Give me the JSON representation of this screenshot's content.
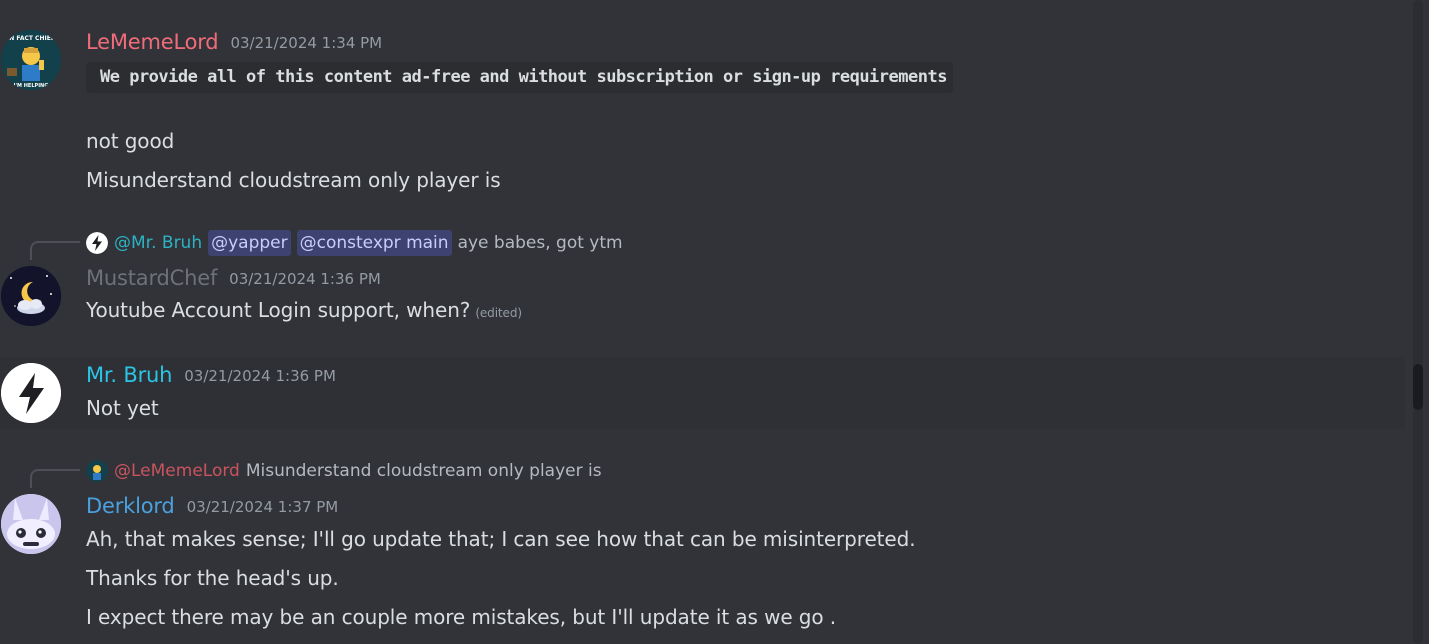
{
  "messages": [
    {
      "author": "LeMemeLord",
      "author_color": "#f16c7a",
      "timestamp": "03/21/2024 1:34 PM",
      "code": "We provide all of this content ad-free and without subscription or sign-up requirements",
      "lines": [
        "not good",
        "Misunderstand cloudstream only player is"
      ],
      "avatar_text_top": "IN FACT CHIEF",
      "avatar_text_bottom": "I'M HELPING"
    },
    {
      "reply": {
        "author": "@Mr. Bruh",
        "author_color": "#2bb3c4",
        "mentions": [
          "@yapper",
          "@constexpr main"
        ],
        "text": "aye babes, got ytm"
      },
      "author": "MustardChef",
      "author_color": "#6d7179",
      "timestamp": "03/21/2024 1:36 PM",
      "lines": [
        "Youtube Account Login support, when?"
      ],
      "edited": "(edited)"
    },
    {
      "author": "Mr. Bruh",
      "author_color": "#2bc4e6",
      "timestamp": "03/21/2024 1:36 PM",
      "lines": [
        "Not yet"
      ]
    },
    {
      "reply": {
        "author": "@LeMemeLord",
        "author_color": "#c9545f",
        "text": "Misunderstand cloudstream only player is"
      },
      "author": "Derklord",
      "author_color": "#4aa1e0",
      "timestamp": "03/21/2024 1:37 PM",
      "lines": [
        "Ah, that makes sense; I'll go update that; I can see how that can be misinterpreted.",
        "Thanks for the head's up.",
        "I expect there may be an couple more mistakes, but I'll update it as we go ."
      ]
    }
  ]
}
